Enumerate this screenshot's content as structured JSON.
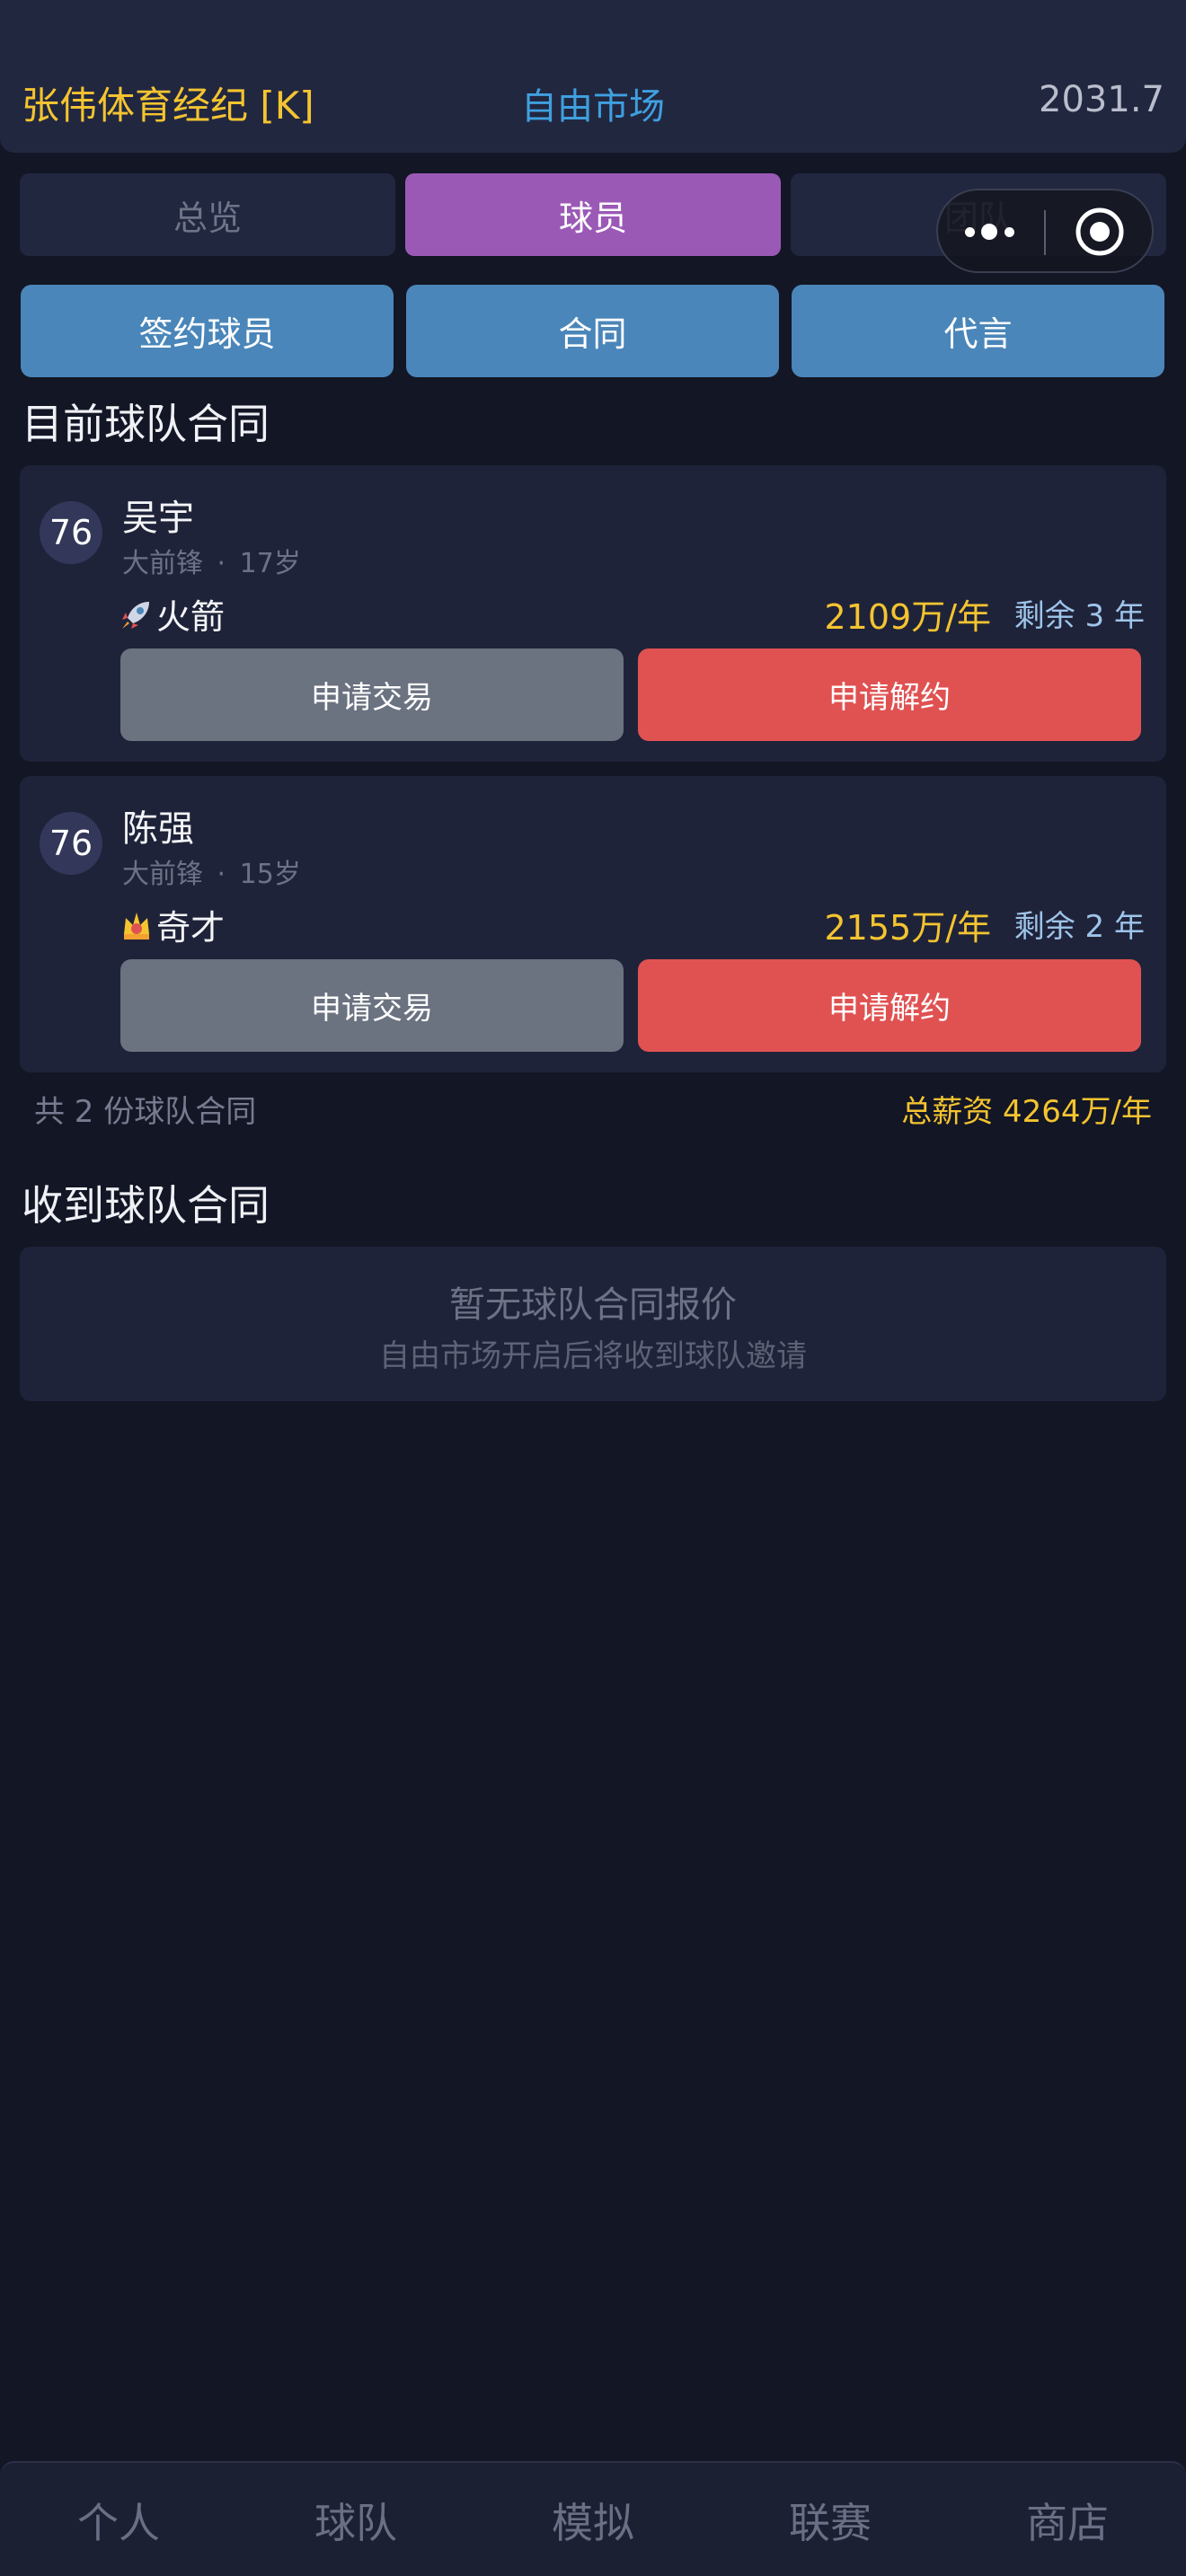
{
  "header": {
    "agency": "张伟体育经纪 [K]",
    "mode": "自由市场",
    "balance": "2031.7"
  },
  "tabs": [
    {
      "label": "总览",
      "active": false
    },
    {
      "label": "球员",
      "active": true
    },
    {
      "label": "团队",
      "active": false
    }
  ],
  "subtabs": [
    {
      "label": "签约球员"
    },
    {
      "label": "合同"
    },
    {
      "label": "代言"
    }
  ],
  "current_contracts": {
    "title": "目前球队合同",
    "players": [
      {
        "rating": "76",
        "name": "吴宇",
        "position": "大前锋",
        "age": "17岁",
        "trait_icon": "rocket-icon",
        "trait": "火箭",
        "salary": "2109万/年",
        "remaining": "剩余 3 年",
        "trade_label": "申请交易",
        "release_label": "申请解约"
      },
      {
        "rating": "76",
        "name": "陈强",
        "position": "大前锋",
        "age": "15岁",
        "trait_icon": "crown-icon",
        "trait": "奇才",
        "salary": "2155万/年",
        "remaining": "剩余 2 年",
        "trade_label": "申请交易",
        "release_label": "申请解约"
      }
    ],
    "count_text": "共 2 份球队合同",
    "total_salary": "总薪资 4264万/年"
  },
  "received_contracts": {
    "title": "收到球队合同",
    "empty_title": "暂无球队合同报价",
    "empty_hint": "自由市场开启后将收到球队邀请"
  },
  "bottom_nav": [
    {
      "label": "个人"
    },
    {
      "label": "球队"
    },
    {
      "label": "模拟"
    },
    {
      "label": "联赛"
    },
    {
      "label": "商店"
    }
  ],
  "colors": {
    "background": "#131625",
    "card": "#1f2339",
    "accent_gold": "#f4c430",
    "accent_purple": "#9b59b6",
    "accent_blue": "#4a86b9",
    "danger": "#e05252"
  }
}
